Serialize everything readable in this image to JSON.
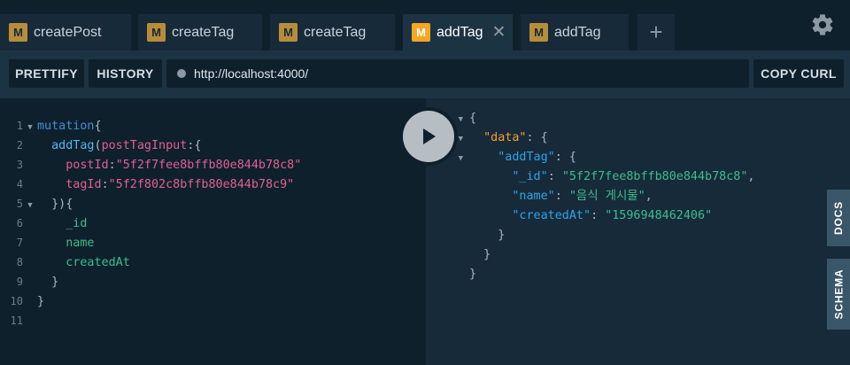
{
  "tabs": [
    {
      "badge": "M",
      "label": "createPost",
      "active": false
    },
    {
      "badge": "M",
      "label": "createTag",
      "active": false
    },
    {
      "badge": "M",
      "label": "createTag",
      "active": false
    },
    {
      "badge": "M",
      "label": "addTag",
      "active": true,
      "close": "✕"
    },
    {
      "badge": "M",
      "label": "addTag",
      "active": false
    }
  ],
  "add_tab_label": "+",
  "toolbar": {
    "prettify_label": "PRETTIFY",
    "history_label": "HISTORY",
    "url": "http://localhost:4000/",
    "copy_curl_label": "COPY CURL"
  },
  "query": {
    "line_numbers": [
      "1",
      "2",
      "3",
      "4",
      "5",
      "6",
      "7",
      "8",
      "9",
      "10",
      "11"
    ],
    "mutation_kw": "mutation",
    "field_name": "addTag",
    "arg_name": "postTagInput",
    "post_id_key": "postId",
    "post_id_value": "\"5f2f7fee8bffb80e844b78c8\"",
    "tag_id_key": "tagId",
    "tag_id_value": "\"5f2f802c8bffb80e844b78c9\"",
    "selections": [
      "_id",
      "name",
      "createdAt"
    ]
  },
  "result": {
    "data_key": "\"data\"",
    "addtag_key": "\"addTag\"",
    "id_key": "\"_id\"",
    "id_value": "\"5f2f7fee8bffb80e844b78c8\"",
    "name_key": "\"name\"",
    "name_value": "\"음식 게시물\"",
    "created_key": "\"createdAt\"",
    "created_value": "\"1596948462406\""
  },
  "side_tabs": {
    "docs": "DOCS",
    "schema": "SCHEMA"
  },
  "colors": {
    "accent_badge": "#f6a623",
    "badge": "#b78d3a",
    "string": "#e06091",
    "field": "#3bbf8c",
    "key": "#2fa4e7"
  }
}
